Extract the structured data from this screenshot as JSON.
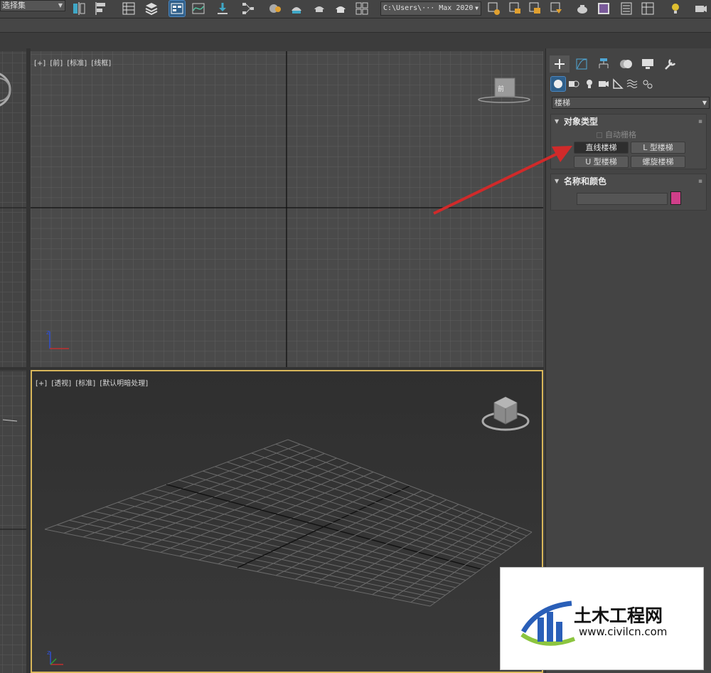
{
  "toolbar": {
    "selection_set": "选择集",
    "project_path": "C:\\Users\\··· Max 2020"
  },
  "viewports": {
    "front": {
      "label": [
        "[+]",
        "[前]",
        "[标准]",
        "[线框]"
      ]
    },
    "perspective": {
      "label": [
        "[+]",
        "[透视]",
        "[标准]",
        "[默认明暗处理]"
      ]
    }
  },
  "command_panel": {
    "tabs": [
      "create-icon",
      "modify-icon",
      "hierarchy-icon",
      "motion-icon",
      "display-icon",
      "utilities-icon"
    ],
    "categories": [
      "geometry-icon",
      "shapes-icon",
      "lights-icon",
      "cameras-icon",
      "helpers-icon",
      "spacewarps-icon",
      "systems-icon"
    ],
    "type_dropdown": "楼梯",
    "object_type": {
      "title": "对象类型",
      "auto_grid": "自动栅格",
      "buttons": [
        "直线楼梯",
        "L 型楼梯",
        "U 型楼梯",
        "螺旋楼梯"
      ],
      "pressed": "直线楼梯"
    },
    "name_color": {
      "title": "名称和颜色",
      "name_value": "",
      "color": "#d03f8a"
    }
  },
  "watermark": {
    "title": "土木工程网",
    "url": "www.civilcn.com"
  },
  "colors": {
    "accent_blue": "#2f5f8a",
    "viewport_active_border": "#d8b65a",
    "annotation_arrow": "#d02a2a"
  }
}
